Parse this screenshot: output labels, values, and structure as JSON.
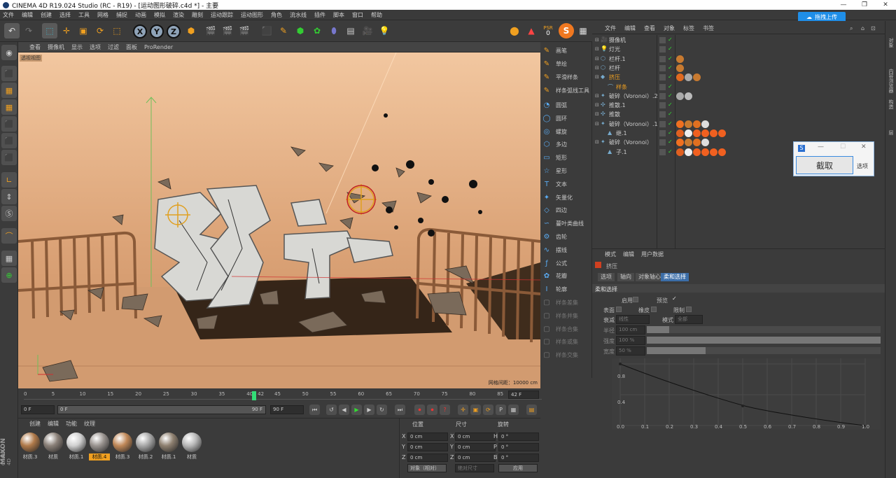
{
  "window": {
    "title": "CINEMA 4D R19.024 Studio (RC - R19) - [运动图形破碎.c4d *] - 主要"
  },
  "menu": [
    "文件",
    "编辑",
    "创建",
    "选择",
    "工具",
    "网格",
    "捕捉",
    "动画",
    "模拟",
    "渲染",
    "雕刻",
    "运动跟踪",
    "运动图形",
    "角色",
    "流水线",
    "插件",
    "脚本",
    "窗口",
    "帮助"
  ],
  "upload_button": "拖拽上传",
  "toolbar": {
    "x": "X",
    "y": "Y",
    "z": "Z",
    "psr": "PSR",
    "psr_val": "0"
  },
  "viewport": {
    "menu": [
      "查看",
      "摄像机",
      "显示",
      "选项",
      "过滤",
      "面板",
      "ProRender"
    ],
    "label": "透视视图",
    "grid_info": "网格间距：10000 cm"
  },
  "spline_panel": {
    "items": [
      {
        "label": "画笔",
        "dim": false
      },
      {
        "label": "草绘",
        "dim": false
      },
      {
        "label": "平滑样条",
        "dim": false
      },
      {
        "label": "样条弧线工具",
        "dim": false
      },
      {
        "label": "圆弧",
        "dim": false
      },
      {
        "label": "圆环",
        "dim": false
      },
      {
        "label": "螺旋",
        "dim": false
      },
      {
        "label": "多边",
        "dim": false
      },
      {
        "label": "矩形",
        "dim": false
      },
      {
        "label": "星形",
        "dim": false
      },
      {
        "label": "文本",
        "dim": false
      },
      {
        "label": "矢量化",
        "dim": false
      },
      {
        "label": "四边",
        "dim": false
      },
      {
        "label": "蔓叶类曲线",
        "dim": false
      },
      {
        "label": "齿轮",
        "dim": false
      },
      {
        "label": "摆线",
        "dim": false
      },
      {
        "label": "公式",
        "dim": false
      },
      {
        "label": "花瓣",
        "dim": false
      },
      {
        "label": "轮廓",
        "dim": false
      },
      {
        "label": "样条差集",
        "dim": true
      },
      {
        "label": "样条并集",
        "dim": true
      },
      {
        "label": "样条合集",
        "dim": true
      },
      {
        "label": "样条或集",
        "dim": true
      },
      {
        "label": "样条交集",
        "dim": true
      }
    ]
  },
  "object_manager": {
    "menu": [
      "文件",
      "编辑",
      "查看",
      "对象",
      "标签",
      "书签"
    ],
    "rows": [
      {
        "name": "摄像机",
        "indent": 0,
        "sel": false
      },
      {
        "name": "灯光",
        "indent": 0,
        "sel": false
      },
      {
        "name": "栏杆.1",
        "indent": 0,
        "sel": false
      },
      {
        "name": "栏杆",
        "indent": 0,
        "sel": false
      },
      {
        "name": "挤压",
        "indent": 0,
        "sel": true
      },
      {
        "name": "样条",
        "indent": 1,
        "sel": true
      },
      {
        "name": "破碎（Voronoi）.2",
        "indent": 0,
        "sel": false
      },
      {
        "name": "推散.1",
        "indent": 0,
        "sel": false
      },
      {
        "name": "推散",
        "indent": 0,
        "sel": false
      },
      {
        "name": "破碎（Voronoi）.1",
        "indent": 0,
        "sel": false
      },
      {
        "name": "继.1",
        "indent": 1,
        "sel": false
      },
      {
        "name": "破碎（Voronoi）",
        "indent": 0,
        "sel": false
      },
      {
        "name": "子.1",
        "indent": 1,
        "sel": false
      }
    ]
  },
  "capture_popup": {
    "button": "截取",
    "option": "选项"
  },
  "ime": [
    "中",
    "•,",
    "☺",
    "⌨"
  ],
  "right_strip": [
    "对象",
    "内容浏览器",
    "构造",
    "层"
  ],
  "attributes": {
    "menu": [
      "模式",
      "编辑",
      "用户数据"
    ],
    "object": "挤压",
    "tabs": [
      "选项",
      "轴向",
      "对象轴心",
      "柔和选择"
    ],
    "section": "柔和选择",
    "enable": "启用",
    "preview": "预览",
    "surface": "表面",
    "rubber": "橡皮",
    "limit": "限制",
    "falloff_label": "衰减",
    "falloff_value": "线性",
    "mode_label": "模式",
    "mode_value": "全部",
    "radius_label": "半径",
    "radius_value": "100 cm",
    "strength_label": "强度",
    "strength_value": "100 %",
    "strength_pct": 100,
    "width_label": "宽度",
    "width_value": "50 %",
    "width_pct": 50,
    "graph_y": [
      "0.8",
      "0.4"
    ],
    "graph_x": [
      "0.0",
      "0.1",
      "0.2",
      "0.3",
      "0.4",
      "0.5",
      "0.6",
      "0.7",
      "0.8",
      "0.9",
      "1.0"
    ]
  },
  "timeline": {
    "ticks": [
      "0",
      "5",
      "10",
      "15",
      "20",
      "25",
      "30",
      "35",
      "40",
      "42",
      "45",
      "50",
      "55",
      "60",
      "65",
      "70",
      "75",
      "80",
      "85",
      "90"
    ],
    "end_field": "42 F",
    "start": "0 F",
    "range_start": "0 F",
    "range_end": "90 F",
    "end": "90 F",
    "current": 42
  },
  "materials": {
    "menu": [
      "创建",
      "编辑",
      "功能",
      "纹理"
    ],
    "items": [
      {
        "label": "材质.3",
        "color": "#b07a4a"
      },
      {
        "label": "材质",
        "color": "#8a8078"
      },
      {
        "label": "材质.1",
        "color": "#d0d0d0"
      },
      {
        "label": "材质.4",
        "color": "#9a9490"
      },
      {
        "label": "材质.3",
        "color": "#c08858"
      },
      {
        "label": "材质.2",
        "color": "#a8a8a8"
      },
      {
        "label": "材质.1",
        "color": "#8e8070"
      },
      {
        "label": "材质",
        "color": "#b8b8b8"
      }
    ],
    "selected_index": 3
  },
  "coords": {
    "headers": [
      "位置",
      "尺寸",
      "旋转"
    ],
    "rows": [
      {
        "a": "X",
        "pos": "0 cm",
        "b": "X",
        "size": "0 cm",
        "c": "H",
        "rot": "0 °"
      },
      {
        "a": "Y",
        "pos": "0 cm",
        "b": "Y",
        "size": "0 cm",
        "c": "P",
        "rot": "0 °"
      },
      {
        "a": "Z",
        "pos": "0 cm",
        "b": "Z",
        "size": "0 cm",
        "c": "B",
        "rot": "0 °"
      }
    ],
    "mode": "对象（相对）",
    "size_mode": "绝对尺寸",
    "apply": "应用"
  },
  "branding": {
    "maxon": "MAXON",
    "c4d": "CINEMA 4D"
  },
  "colors": {
    "accent": "#3c6ea8",
    "upload": "#1f8ee8",
    "playhead": "#33dd77",
    "viewport_bg": "#d9a67a"
  }
}
